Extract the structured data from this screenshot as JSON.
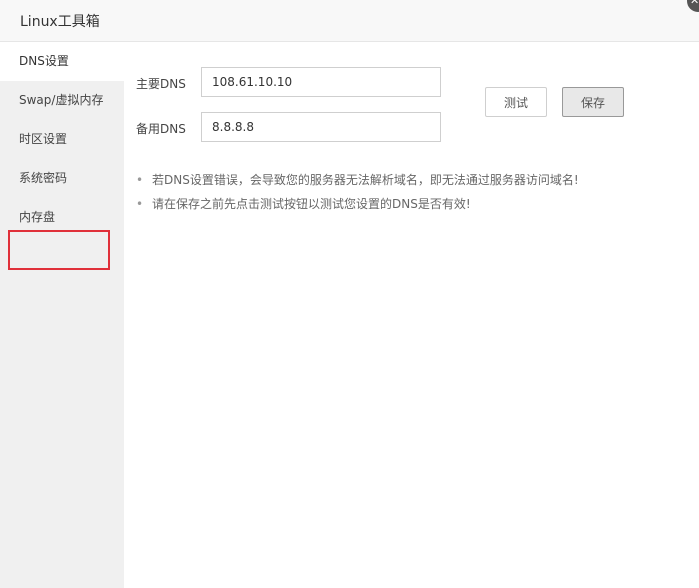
{
  "window": {
    "title": "Linux工具箱",
    "close_glyph": "✕"
  },
  "sidebar": {
    "items": [
      {
        "label": "DNS设置",
        "active": true
      },
      {
        "label": "Swap/虚拟内存",
        "active": false
      },
      {
        "label": "时区设置",
        "active": false
      },
      {
        "label": "系统密码",
        "active": false
      },
      {
        "label": "内存盘",
        "active": false
      }
    ]
  },
  "dns": {
    "primary_label": "主要DNS",
    "primary_value": "108.61.10.10",
    "secondary_label": "备用DNS",
    "secondary_value": "8.8.8.8",
    "test_button": "测试",
    "save_button": "保存"
  },
  "tips": [
    "若DNS设置错误，会导致您的服务器无法解析域名，即无法通过服务器访问域名!",
    "请在保存之前先点击测试按钮以测试您设置的DNS是否有效!"
  ],
  "colors": {
    "highlight_border": "#e0303a",
    "sidebar_bg": "#f0f0f0"
  }
}
